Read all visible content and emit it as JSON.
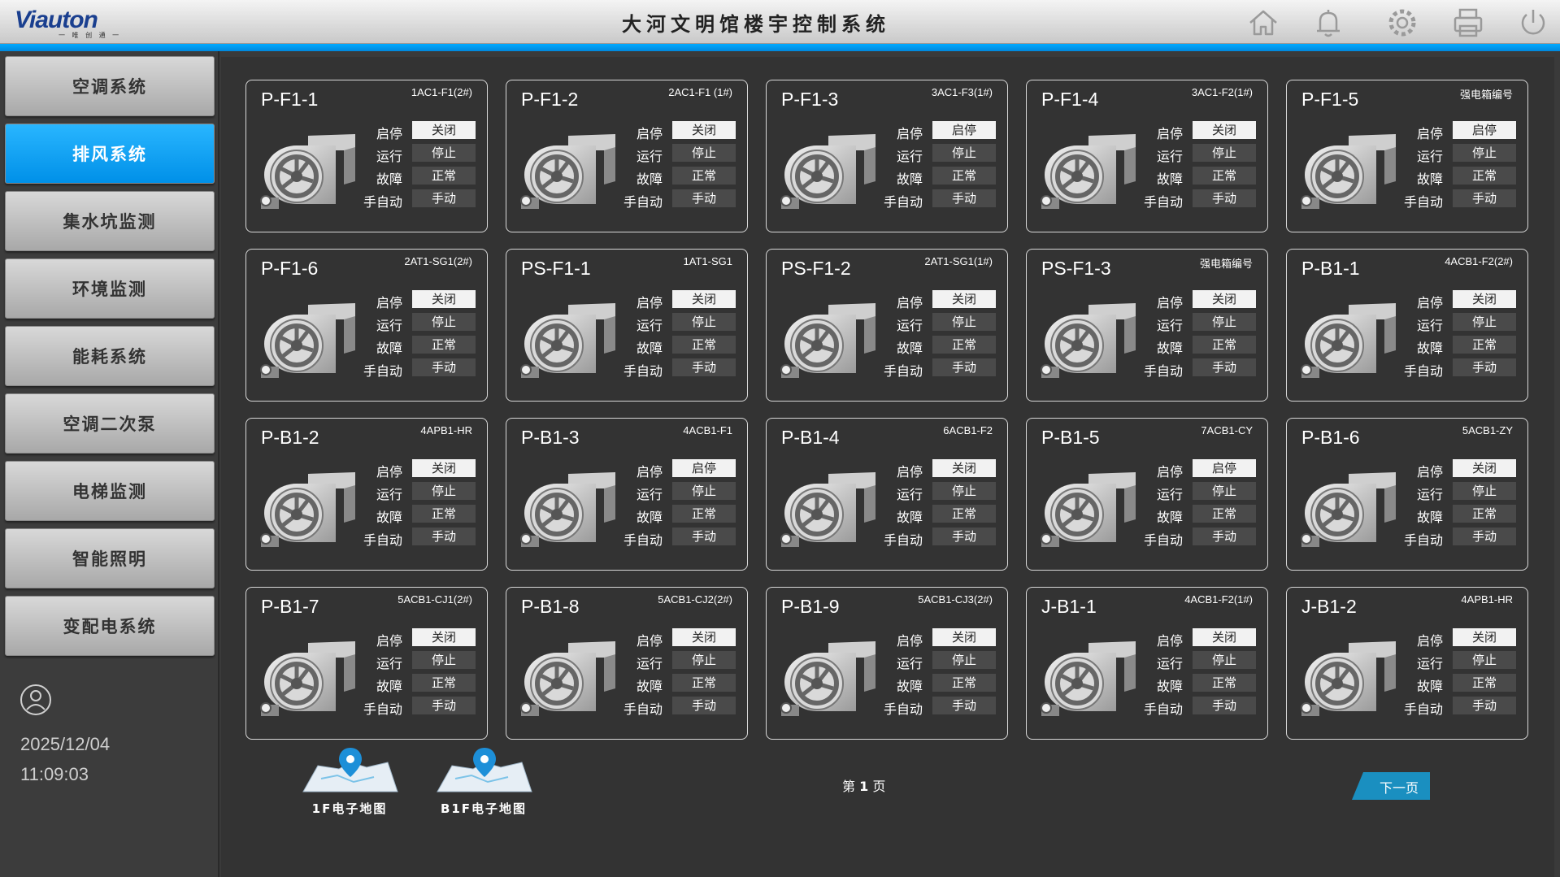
{
  "header": {
    "logo": "Viauton",
    "logo_sub": "一 唯 创 通 一",
    "title": "大河文明馆楼宇控制系统",
    "icons": [
      "home-icon",
      "bell-icon",
      "gear-icon",
      "printer-icon",
      "power-icon"
    ]
  },
  "sidebar": {
    "items": [
      {
        "label": "空调系统"
      },
      {
        "label": "排风系统"
      },
      {
        "label": "集水坑监测"
      },
      {
        "label": "环境监测"
      },
      {
        "label": "能耗系统"
      },
      {
        "label": "空调二次泵"
      },
      {
        "label": "电梯监测"
      },
      {
        "label": "智能照明"
      },
      {
        "label": "变配电系统"
      }
    ],
    "active_index": 1,
    "date": "2025/12/04",
    "time": "11:09:03"
  },
  "labels": {
    "start_stop": "启停",
    "running": "运行",
    "fault": "故障",
    "mode": "手自动"
  },
  "devices": [
    {
      "name": "P-F1-1",
      "code": "1AC1-F1(2#)",
      "start_stop": "关闭",
      "running": "停止",
      "fault": "正常",
      "mode": "手动"
    },
    {
      "name": "P-F1-2",
      "code": "2AC1-F1 (1#)",
      "start_stop": "关闭",
      "running": "停止",
      "fault": "正常",
      "mode": "手动"
    },
    {
      "name": "P-F1-3",
      "code": "3AC1-F3(1#)",
      "start_stop": "启停",
      "running": "停止",
      "fault": "正常",
      "mode": "手动"
    },
    {
      "name": "P-F1-4",
      "code": "3AC1-F2(1#)",
      "start_stop": "关闭",
      "running": "停止",
      "fault": "正常",
      "mode": "手动"
    },
    {
      "name": "P-F1-5",
      "code": "强电箱编号",
      "start_stop": "启停",
      "running": "停止",
      "fault": "正常",
      "mode": "手动"
    },
    {
      "name": "P-F1-6",
      "code": "2AT1-SG1(2#)",
      "start_stop": "关闭",
      "running": "停止",
      "fault": "正常",
      "mode": "手动"
    },
    {
      "name": "PS-F1-1",
      "code": "1AT1-SG1",
      "start_stop": "关闭",
      "running": "停止",
      "fault": "正常",
      "mode": "手动"
    },
    {
      "name": "PS-F1-2",
      "code": "2AT1-SG1(1#)",
      "start_stop": "关闭",
      "running": "停止",
      "fault": "正常",
      "mode": "手动"
    },
    {
      "name": "PS-F1-3",
      "code": "强电箱编号",
      "start_stop": "关闭",
      "running": "停止",
      "fault": "正常",
      "mode": "手动"
    },
    {
      "name": "P-B1-1",
      "code": "4ACB1-F2(2#)",
      "start_stop": "关闭",
      "running": "停止",
      "fault": "正常",
      "mode": "手动"
    },
    {
      "name": "P-B1-2",
      "code": "4APB1-HR",
      "start_stop": "关闭",
      "running": "停止",
      "fault": "正常",
      "mode": "手动"
    },
    {
      "name": "P-B1-3",
      "code": "4ACB1-F1",
      "start_stop": "启停",
      "running": "停止",
      "fault": "正常",
      "mode": "手动"
    },
    {
      "name": "P-B1-4",
      "code": "6ACB1-F2",
      "start_stop": "关闭",
      "running": "停止",
      "fault": "正常",
      "mode": "手动"
    },
    {
      "name": "P-B1-5",
      "code": "7ACB1-CY",
      "start_stop": "启停",
      "running": "停止",
      "fault": "正常",
      "mode": "手动"
    },
    {
      "name": "P-B1-6",
      "code": "5ACB1-ZY",
      "start_stop": "关闭",
      "running": "停止",
      "fault": "正常",
      "mode": "手动"
    },
    {
      "name": "P-B1-7",
      "code": "5ACB1-CJ1(2#)",
      "start_stop": "关闭",
      "running": "停止",
      "fault": "正常",
      "mode": "手动"
    },
    {
      "name": "P-B1-8",
      "code": "5ACB1-CJ2(2#)",
      "start_stop": "关闭",
      "running": "停止",
      "fault": "正常",
      "mode": "手动"
    },
    {
      "name": "P-B1-9",
      "code": "5ACB1-CJ3(2#)",
      "start_stop": "关闭",
      "running": "停止",
      "fault": "正常",
      "mode": "手动"
    },
    {
      "name": "J-B1-1",
      "code": "4ACB1-F2(1#)",
      "start_stop": "关闭",
      "running": "停止",
      "fault": "正常",
      "mode": "手动"
    },
    {
      "name": "J-B1-2",
      "code": "4APB1-HR",
      "start_stop": "关闭",
      "running": "停止",
      "fault": "正常",
      "mode": "手动"
    }
  ],
  "footer": {
    "map_1f": "1F电子地图",
    "map_b1f": "B1F电子地图",
    "page_prefix": "第",
    "page_number": "1",
    "page_suffix": "页",
    "next_label": "下一页"
  },
  "colors": {
    "accent": "#0a9ef0",
    "background": "#333333",
    "value_light": "#f2f2f2",
    "value_dark": "#4a4a4a"
  }
}
